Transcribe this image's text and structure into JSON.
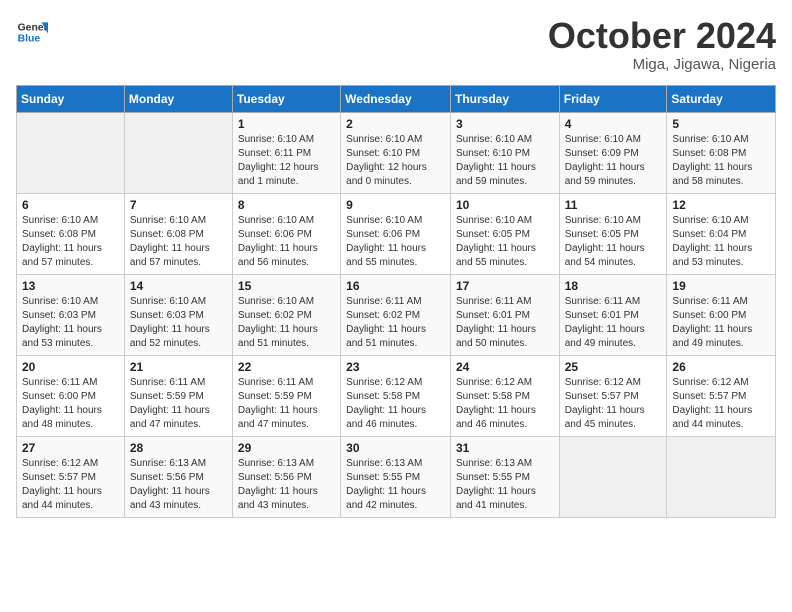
{
  "header": {
    "logo_line1": "General",
    "logo_line2": "Blue",
    "month": "October 2024",
    "location": "Miga, Jigawa, Nigeria"
  },
  "weekdays": [
    "Sunday",
    "Monday",
    "Tuesday",
    "Wednesday",
    "Thursday",
    "Friday",
    "Saturday"
  ],
  "weeks": [
    [
      {
        "day": "",
        "info": ""
      },
      {
        "day": "",
        "info": ""
      },
      {
        "day": "1",
        "info": "Sunrise: 6:10 AM\nSunset: 6:11 PM\nDaylight: 12 hours\nand 1 minute."
      },
      {
        "day": "2",
        "info": "Sunrise: 6:10 AM\nSunset: 6:10 PM\nDaylight: 12 hours\nand 0 minutes."
      },
      {
        "day": "3",
        "info": "Sunrise: 6:10 AM\nSunset: 6:10 PM\nDaylight: 11 hours\nand 59 minutes."
      },
      {
        "day": "4",
        "info": "Sunrise: 6:10 AM\nSunset: 6:09 PM\nDaylight: 11 hours\nand 59 minutes."
      },
      {
        "day": "5",
        "info": "Sunrise: 6:10 AM\nSunset: 6:08 PM\nDaylight: 11 hours\nand 58 minutes."
      }
    ],
    [
      {
        "day": "6",
        "info": "Sunrise: 6:10 AM\nSunset: 6:08 PM\nDaylight: 11 hours\nand 57 minutes."
      },
      {
        "day": "7",
        "info": "Sunrise: 6:10 AM\nSunset: 6:08 PM\nDaylight: 11 hours\nand 57 minutes."
      },
      {
        "day": "8",
        "info": "Sunrise: 6:10 AM\nSunset: 6:06 PM\nDaylight: 11 hours\nand 56 minutes."
      },
      {
        "day": "9",
        "info": "Sunrise: 6:10 AM\nSunset: 6:06 PM\nDaylight: 11 hours\nand 55 minutes."
      },
      {
        "day": "10",
        "info": "Sunrise: 6:10 AM\nSunset: 6:05 PM\nDaylight: 11 hours\nand 55 minutes."
      },
      {
        "day": "11",
        "info": "Sunrise: 6:10 AM\nSunset: 6:05 PM\nDaylight: 11 hours\nand 54 minutes."
      },
      {
        "day": "12",
        "info": "Sunrise: 6:10 AM\nSunset: 6:04 PM\nDaylight: 11 hours\nand 53 minutes."
      }
    ],
    [
      {
        "day": "13",
        "info": "Sunrise: 6:10 AM\nSunset: 6:03 PM\nDaylight: 11 hours\nand 53 minutes."
      },
      {
        "day": "14",
        "info": "Sunrise: 6:10 AM\nSunset: 6:03 PM\nDaylight: 11 hours\nand 52 minutes."
      },
      {
        "day": "15",
        "info": "Sunrise: 6:10 AM\nSunset: 6:02 PM\nDaylight: 11 hours\nand 51 minutes."
      },
      {
        "day": "16",
        "info": "Sunrise: 6:11 AM\nSunset: 6:02 PM\nDaylight: 11 hours\nand 51 minutes."
      },
      {
        "day": "17",
        "info": "Sunrise: 6:11 AM\nSunset: 6:01 PM\nDaylight: 11 hours\nand 50 minutes."
      },
      {
        "day": "18",
        "info": "Sunrise: 6:11 AM\nSunset: 6:01 PM\nDaylight: 11 hours\nand 49 minutes."
      },
      {
        "day": "19",
        "info": "Sunrise: 6:11 AM\nSunset: 6:00 PM\nDaylight: 11 hours\nand 49 minutes."
      }
    ],
    [
      {
        "day": "20",
        "info": "Sunrise: 6:11 AM\nSunset: 6:00 PM\nDaylight: 11 hours\nand 48 minutes."
      },
      {
        "day": "21",
        "info": "Sunrise: 6:11 AM\nSunset: 5:59 PM\nDaylight: 11 hours\nand 47 minutes."
      },
      {
        "day": "22",
        "info": "Sunrise: 6:11 AM\nSunset: 5:59 PM\nDaylight: 11 hours\nand 47 minutes."
      },
      {
        "day": "23",
        "info": "Sunrise: 6:12 AM\nSunset: 5:58 PM\nDaylight: 11 hours\nand 46 minutes."
      },
      {
        "day": "24",
        "info": "Sunrise: 6:12 AM\nSunset: 5:58 PM\nDaylight: 11 hours\nand 46 minutes."
      },
      {
        "day": "25",
        "info": "Sunrise: 6:12 AM\nSunset: 5:57 PM\nDaylight: 11 hours\nand 45 minutes."
      },
      {
        "day": "26",
        "info": "Sunrise: 6:12 AM\nSunset: 5:57 PM\nDaylight: 11 hours\nand 44 minutes."
      }
    ],
    [
      {
        "day": "27",
        "info": "Sunrise: 6:12 AM\nSunset: 5:57 PM\nDaylight: 11 hours\nand 44 minutes."
      },
      {
        "day": "28",
        "info": "Sunrise: 6:13 AM\nSunset: 5:56 PM\nDaylight: 11 hours\nand 43 minutes."
      },
      {
        "day": "29",
        "info": "Sunrise: 6:13 AM\nSunset: 5:56 PM\nDaylight: 11 hours\nand 43 minutes."
      },
      {
        "day": "30",
        "info": "Sunrise: 6:13 AM\nSunset: 5:55 PM\nDaylight: 11 hours\nand 42 minutes."
      },
      {
        "day": "31",
        "info": "Sunrise: 6:13 AM\nSunset: 5:55 PM\nDaylight: 11 hours\nand 41 minutes."
      },
      {
        "day": "",
        "info": ""
      },
      {
        "day": "",
        "info": ""
      }
    ]
  ]
}
